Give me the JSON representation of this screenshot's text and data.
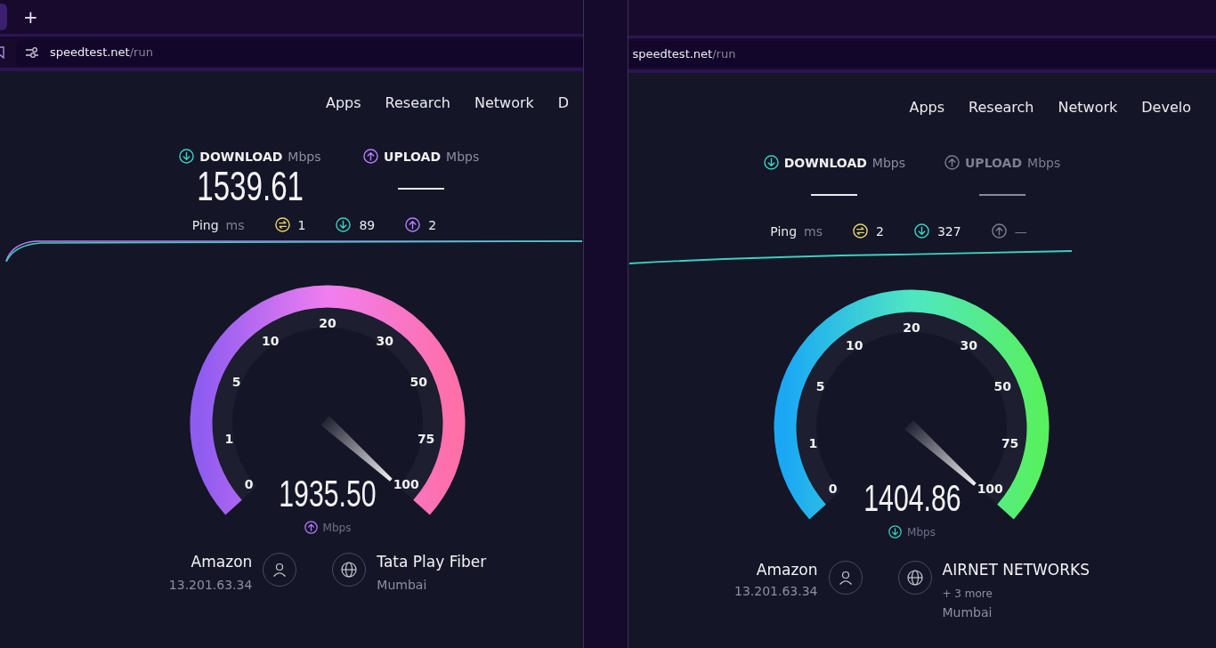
{
  "windows": [
    {
      "tab_strip": {
        "new_tab": "+",
        "tab_cut": true
      },
      "address": {
        "domain": "speedtest.net",
        "path": "/run",
        "site_icon": true
      },
      "nav": [
        "Apps",
        "Research",
        "Network",
        "D"
      ],
      "results": [
        {
          "kind": "download",
          "label": "DOWNLOAD",
          "unit": "Mbps",
          "value": "1539.61",
          "dimmed": false
        },
        {
          "kind": "upload",
          "label": "UPLOAD",
          "unit": "Mbps",
          "dimmed": false
        }
      ],
      "ping": {
        "label": "Ping",
        "unit": "ms",
        "items": [
          {
            "kind": "jitter",
            "value": "1",
            "dimmed": false
          },
          {
            "kind": "download",
            "value": "89",
            "dimmed": false
          },
          {
            "kind": "upload",
            "value": "2",
            "dimmed": false
          }
        ]
      },
      "gauge": {
        "kind": "upload",
        "scale": [
          "0",
          "1",
          "5",
          "10",
          "20",
          "30",
          "50",
          "75",
          "100"
        ],
        "reading": "1935.50",
        "unit": "Mbps"
      },
      "server": {
        "name": "Amazon",
        "ip": "13.201.63.34"
      },
      "provider": {
        "name": "Tata Play Fiber",
        "location": "Mumbai"
      }
    },
    {
      "tab_strip": {
        "tab_cut": false
      },
      "address": {
        "domain": "speedtest.net",
        "path": "/run",
        "site_icon": false
      },
      "nav": [
        "Apps",
        "Research",
        "Network",
        "Develo"
      ],
      "results": [
        {
          "kind": "download",
          "label": "DOWNLOAD",
          "unit": "Mbps",
          "dimmed": false
        },
        {
          "kind": "upload",
          "label": "UPLOAD",
          "unit": "Mbps",
          "dimmed": true
        }
      ],
      "ping": {
        "label": "Ping",
        "unit": "ms",
        "items": [
          {
            "kind": "jitter",
            "value": "2",
            "dimmed": false
          },
          {
            "kind": "download",
            "value": "327",
            "dimmed": false
          },
          {
            "kind": "upload",
            "value": "—",
            "dimmed": true
          }
        ]
      },
      "gauge": {
        "kind": "download",
        "scale": [
          "0",
          "1",
          "5",
          "10",
          "20",
          "30",
          "50",
          "75",
          "100"
        ],
        "reading": "1404.86",
        "unit": "Mbps"
      },
      "server": {
        "name": "Amazon",
        "ip": "13.201.63.34"
      },
      "provider": {
        "name": "AIRNET NETWORKS",
        "more": "+ 3 more",
        "location": "Mumbai"
      }
    }
  ]
}
